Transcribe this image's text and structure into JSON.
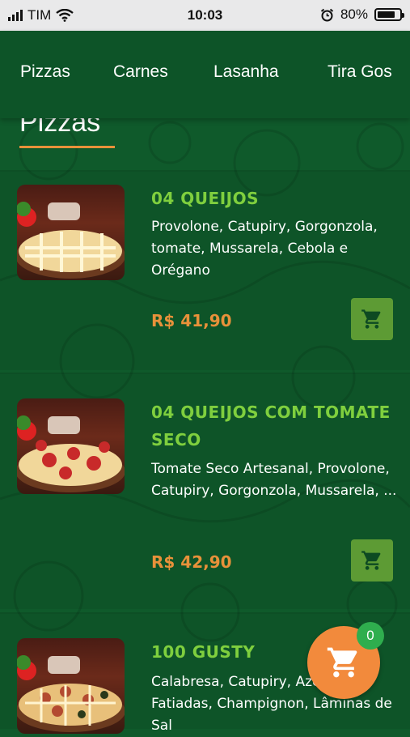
{
  "status_bar": {
    "carrier": "TIM",
    "time": "10:03",
    "battery_percent": "80%",
    "battery_level": 0.8
  },
  "nav": {
    "tabs": [
      "Pizzas",
      "Carnes",
      "Lasanha",
      "Tira Gos"
    ]
  },
  "section": {
    "title": "Pizzas"
  },
  "products": [
    {
      "name": "04 QUEIJOS",
      "description": "Provolone, Catupiry, Gorgonzola, tomate, Mussarela, Cebola e Orégano",
      "price": "R$ 41,90"
    },
    {
      "name": "04 QUEIJOS COM TOMATE SECO",
      "description": "Tomate Seco Artesanal, Provolone, Catupiry, Gorgonzola, Mussarela, ...",
      "price": "R$ 42,90"
    },
    {
      "name": "100 GUSTY",
      "description": "Calabresa, Catupiry, Azeitonas Fatiadas, Champignon, Lâminas de Sal",
      "price": ""
    }
  ],
  "cart": {
    "count": "0"
  },
  "colors": {
    "background": "#0f5a2b",
    "accent_green": "#7fcf3e",
    "price_orange": "#e8913a",
    "cart_button": "#5d9b34",
    "fab": "#f28a3c",
    "badge": "#2fae4e"
  },
  "icons": [
    "signal-icon",
    "wifi-icon",
    "alarm-icon",
    "battery-icon",
    "cart-icon"
  ]
}
